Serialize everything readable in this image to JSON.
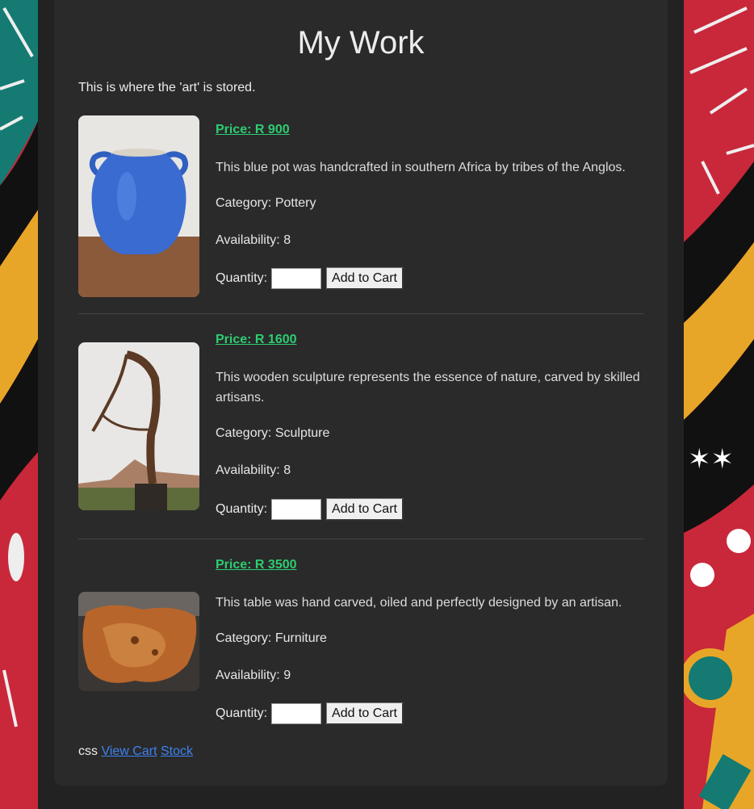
{
  "page": {
    "title": "My Work",
    "intro": "This is where the 'art' is stored."
  },
  "products": [
    {
      "price": "Price: R 900",
      "description": "This blue pot was handcrafted in southern Africa by tribes of the Anglos.",
      "category": "Category: Pottery",
      "availability": "Availability: 8",
      "quantity_label": "Quantity:",
      "quantity_value": "",
      "add_button": "Add to Cart",
      "image": "blue-pot-image"
    },
    {
      "price": "Price: R 1600",
      "description": "This wooden sculpture represents the essence of nature, carved by skilled artisans.",
      "category": "Category: Sculpture",
      "availability": "Availability: 8",
      "quantity_label": "Quantity:",
      "quantity_value": "",
      "add_button": "Add to Cart",
      "image": "wooden-sculpture-image"
    },
    {
      "price": "Price: R 3500",
      "description": "This table was hand carved, oiled and perfectly designed by an artisan.",
      "category": "Category: Furniture",
      "availability": "Availability: 9",
      "quantity_label": "Quantity:",
      "quantity_value": "",
      "add_button": "Add to Cart",
      "image": "wooden-table-image"
    }
  ],
  "footer": {
    "prefix": "css",
    "view_cart": "View Cart",
    "stock": "Stock"
  },
  "colors": {
    "price": "#2ecc71",
    "link": "#3d82f0",
    "card": "#2a2a2a"
  }
}
